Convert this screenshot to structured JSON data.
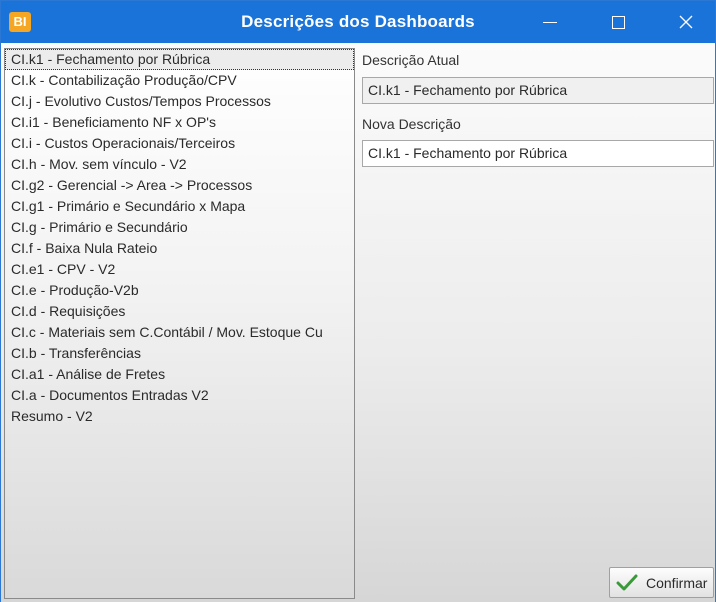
{
  "window": {
    "app_icon_text": "BI",
    "title": "Descrições dos Dashboards"
  },
  "dashboards": {
    "items": [
      "CI.k1 - Fechamento por Rúbrica",
      "CI.k - Contabilização Produção/CPV",
      "CI.j - Evolutivo Custos/Tempos Processos",
      "CI.i1 - Beneficiamento NF x OP's",
      "CI.i - Custos Operacionais/Terceiros",
      "CI.h - Mov. sem vínculo - V2",
      "CI.g2 - Gerencial -> Area -> Processos",
      "CI.g1 - Primário e Secundário x Mapa",
      "CI.g - Primário e Secundário",
      "CI.f - Baixa Nula Rateio",
      "CI.e1 - CPV - V2",
      "CI.e - Produção-V2b",
      "CI.d - Requisições",
      "CI.c - Materiais sem C.Contábil / Mov. Estoque Cu",
      "CI.b - Transferências",
      "CI.a1 - Análise de Fretes",
      "CI.a -  Documentos Entradas V2",
      " Resumo - V2"
    ],
    "selected_index": 0
  },
  "form": {
    "current_label": "Descrição Atual",
    "current_value": "CI.k1 - Fechamento por Rúbrica",
    "new_label": "Nova Descrição",
    "new_value": "CI.k1 - Fechamento por Rúbrica"
  },
  "actions": {
    "confirm_label": "Confirmar"
  },
  "colors": {
    "titlebar": "#1a73d9",
    "app_icon": "#f5a623",
    "confirm_check": "#3a9a3a"
  }
}
